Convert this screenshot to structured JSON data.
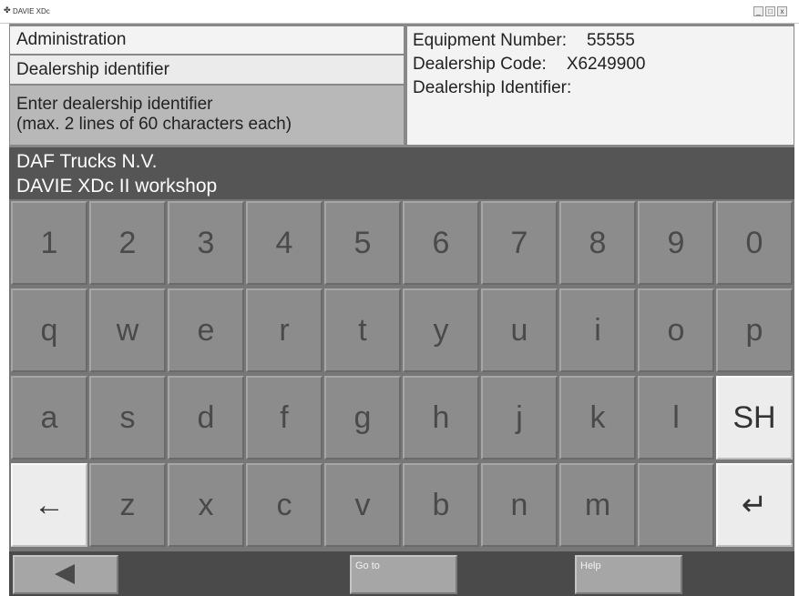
{
  "window": {
    "title": "DAVIE XDc",
    "controls": [
      "_",
      "□",
      "x"
    ]
  },
  "left_panel": {
    "row1": "Administration",
    "row2": "Dealership identifier",
    "instruction_line1": "Enter dealership identifier",
    "instruction_line2": "(max. 2 lines of 60 characters each)"
  },
  "right_panel": {
    "equipment_label": "Equipment Number:",
    "equipment_value": "55555",
    "code_label": "Dealership Code:",
    "code_value": "X6249900",
    "identifier_label": "Dealership Identifier:",
    "identifier_value": ""
  },
  "input": {
    "line1": "DAF Trucks N.V.",
    "line2": "DAVIE XDc II workshop"
  },
  "keyboard": {
    "row1": [
      "1",
      "2",
      "3",
      "4",
      "5",
      "6",
      "7",
      "8",
      "9",
      "0"
    ],
    "row2": [
      "q",
      "w",
      "e",
      "r",
      "t",
      "y",
      "u",
      "i",
      "o",
      "p"
    ],
    "row3": [
      "a",
      "s",
      "d",
      "f",
      "g",
      "h",
      "j",
      "k",
      "l",
      "SH"
    ],
    "row4": [
      "←",
      "z",
      "x",
      "c",
      "v",
      "b",
      "n",
      "m",
      "",
      "↵"
    ]
  },
  "bottom_bar": {
    "back_icon": "left-triangle-icon",
    "goto_label": "Go to",
    "help_label": "Help"
  },
  "colors": {
    "key_gray": "#8c8c8c",
    "key_light": "#ececec",
    "input_bar": "#555555",
    "bottom_bar": "#4a4a4a"
  }
}
